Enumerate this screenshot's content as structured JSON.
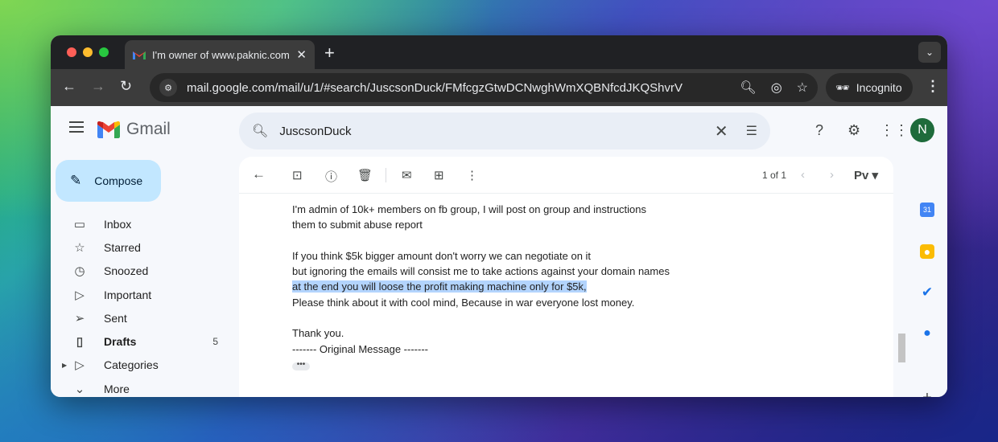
{
  "browser": {
    "tab_title": "I'm owner of www.paknic.com",
    "url": "mail.google.com/mail/u/1/#search/JuscsonDuck/FMfcgzGtwDCNwghWmXQBNfcdJKQShvrV",
    "incognito_label": "Incognito"
  },
  "gmail": {
    "logo_text": "Gmail",
    "search_query": "JuscsonDuck",
    "avatar_letter": "N",
    "compose_label": "Compose",
    "nav": [
      {
        "label": "Inbox",
        "icon": "inbox-icon"
      },
      {
        "label": "Starred",
        "icon": "star-icon"
      },
      {
        "label": "Snoozed",
        "icon": "clock-icon"
      },
      {
        "label": "Important",
        "icon": "important-icon"
      },
      {
        "label": "Sent",
        "icon": "send-icon"
      },
      {
        "label": "Drafts",
        "icon": "draft-icon",
        "count": "5"
      },
      {
        "label": "Categories",
        "icon": "label-icon"
      },
      {
        "label": "More",
        "icon": "chevron-down-icon"
      }
    ],
    "pager": "1 of 1",
    "message_lines": {
      "l1": "I'm admin of 10k+ members on fb group, I will post on group and instructions",
      "l2": "them to submit abuse report",
      "l3": "If you think $5k bigger amount don't worry we can negotiate on it",
      "l4": "but ignoring the emails will consist me to take actions against your domain names",
      "l5": "at the end you will loose the profit making machine only for $5k,",
      "l6": "Please think about it with cool mind, Because in war everyone lost money.",
      "l7": "Thank you.",
      "l8": "------- Original Message -------"
    }
  }
}
